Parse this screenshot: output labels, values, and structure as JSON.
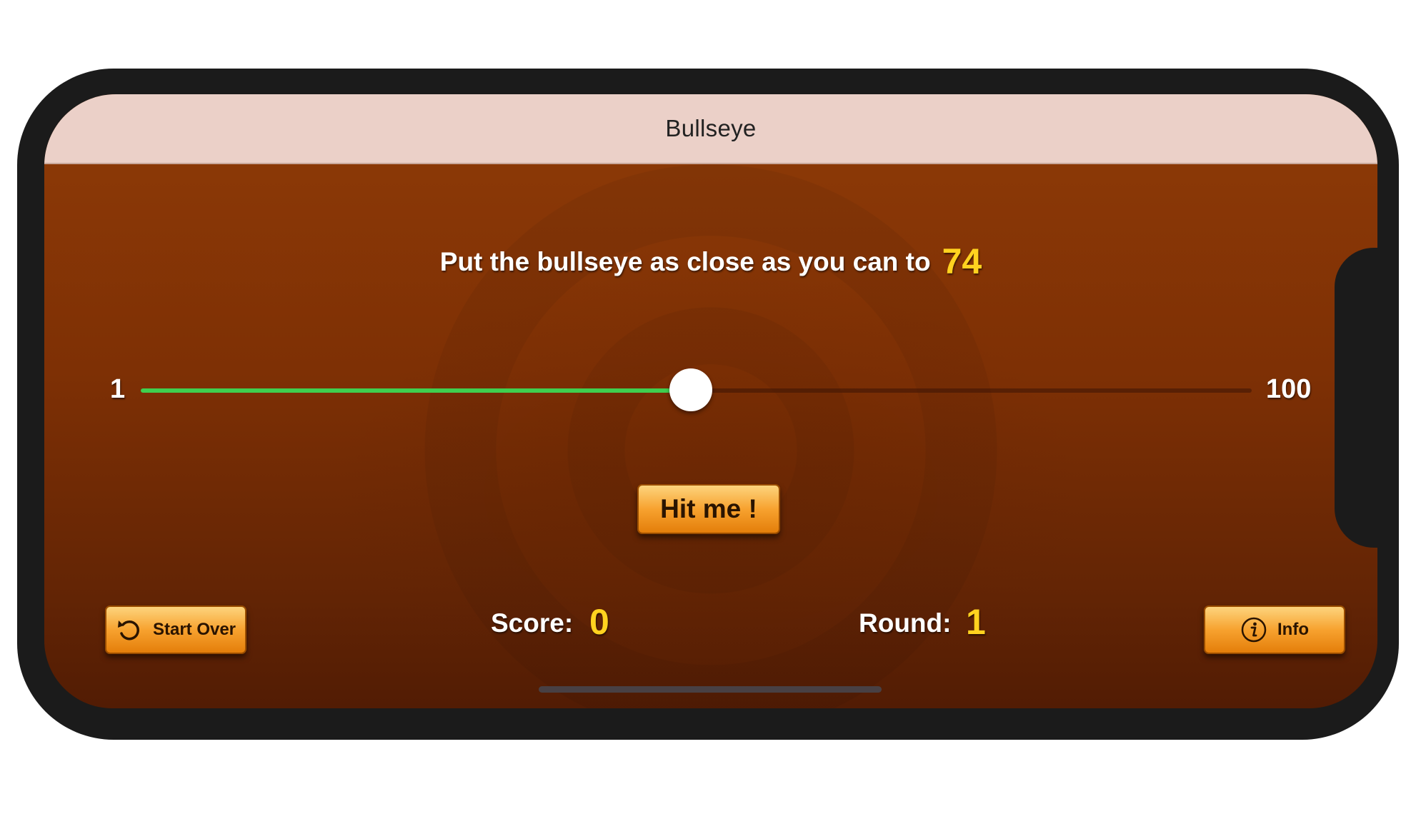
{
  "app": {
    "title": "Bullseye"
  },
  "game": {
    "prompt": "Put the bullseye as close as you can to",
    "target": "74",
    "slider": {
      "min_label": "1",
      "max_label": "100",
      "min": 1,
      "max": 100,
      "value": 50
    },
    "hit_button": "Hit me !",
    "start_over_button": "Start Over",
    "info_button": "Info",
    "score_label": "Score:",
    "score_value": "0",
    "round_label": "Round:",
    "round_value": "1"
  },
  "colors": {
    "accent": "#ffd21f",
    "slider_fill": "#3fcf4f",
    "button": "#f7a22f",
    "background": "#7e3005",
    "navbar": "#ebd0c8"
  },
  "icons": {
    "start_over": "undo-icon",
    "info": "info-icon"
  }
}
